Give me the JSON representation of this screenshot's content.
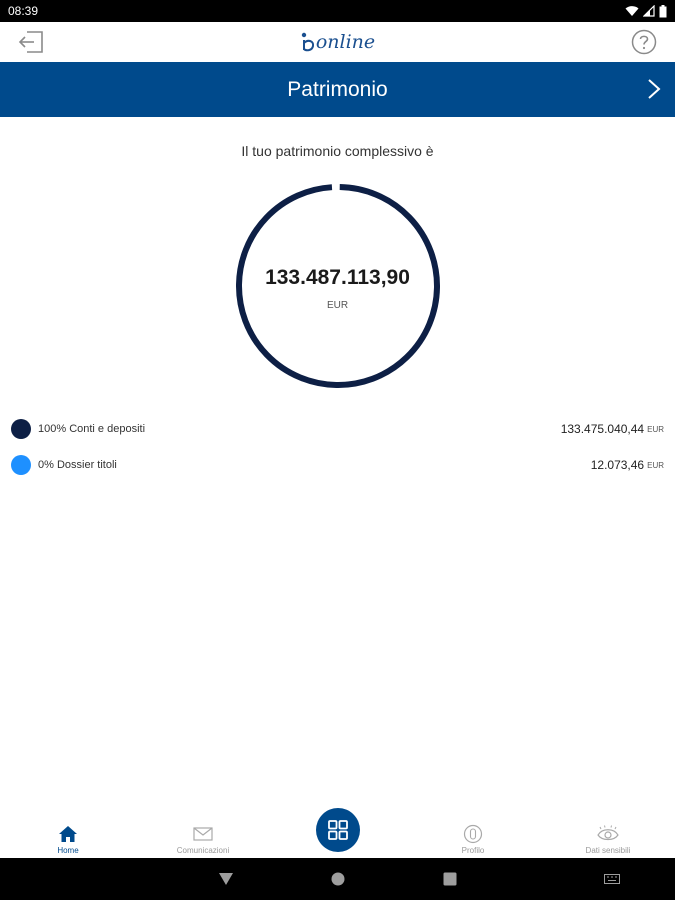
{
  "status": {
    "time": "08:39"
  },
  "app": {
    "logo_text": "online"
  },
  "title_bar": {
    "title": "Patrimonio"
  },
  "summary": {
    "label": "Il tuo patrimonio complessivo è",
    "total": "133.487.113,90",
    "currency": "EUR"
  },
  "breakdown": [
    {
      "label": "100% Conti e depositi",
      "amount": "133.475.040,44",
      "currency": "EUR",
      "color": "#0d1f45"
    },
    {
      "label": "0% Dossier titoli",
      "amount": "12.073,46",
      "currency": "EUR",
      "color": "#1e90ff"
    }
  ],
  "bottom_nav": [
    {
      "label": "Home",
      "icon": "home-icon",
      "active": true
    },
    {
      "label": "Comunicazioni",
      "icon": "envelope-icon",
      "active": false
    },
    {
      "label": "Profilo",
      "icon": "profile-icon",
      "active": false
    },
    {
      "label": "Dati sensibili",
      "icon": "eye-icon",
      "active": false
    }
  ],
  "colors": {
    "brand": "#004a8c",
    "donut": "#0d1f45",
    "securities": "#1e90ff"
  }
}
